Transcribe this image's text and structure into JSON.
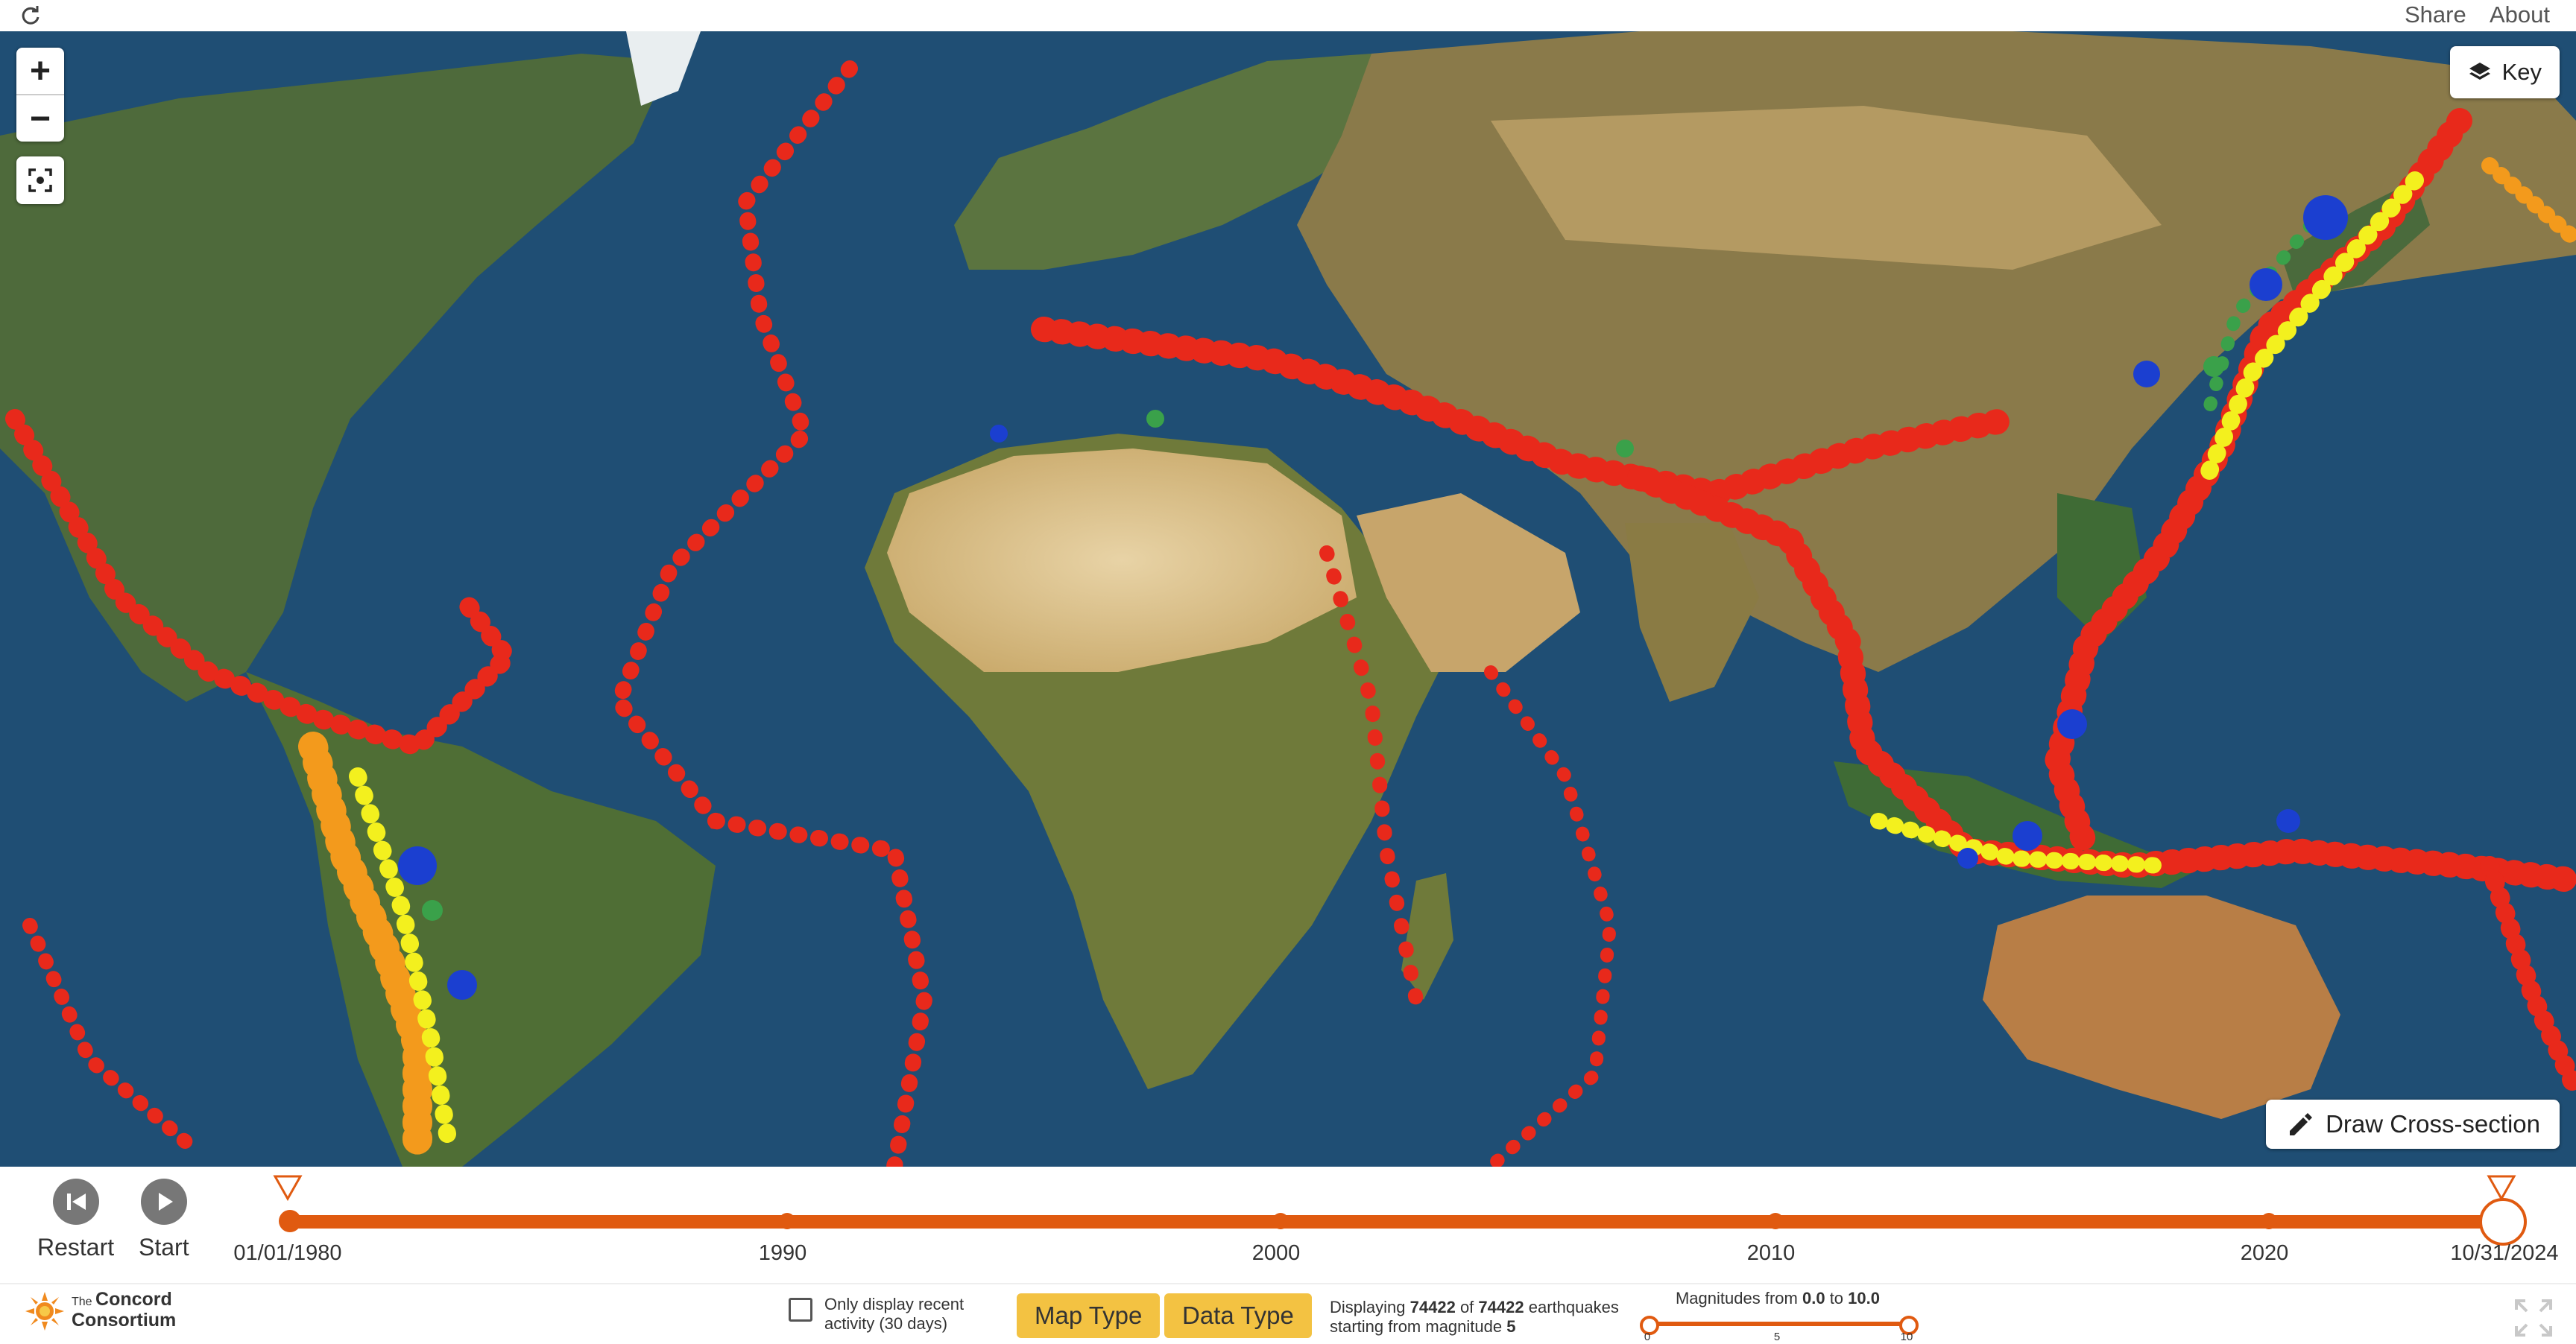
{
  "header": {
    "share_label": "Share",
    "about_label": "About"
  },
  "map": {
    "key_label": "Key",
    "cross_section_label": "Draw Cross-section",
    "zoom_in_label": "+",
    "zoom_out_label": "−"
  },
  "playback": {
    "restart_label": "Restart",
    "start_label": "Start"
  },
  "timeline": {
    "start_date": "01/01/1980",
    "end_date": "10/31/2024",
    "ticks": [
      "1990",
      "2000",
      "2010",
      "2020"
    ]
  },
  "filters": {
    "recent_activity_label": "Only display recent activity (30 days)",
    "map_type_label": "Map Type",
    "data_type_label": "Data Type"
  },
  "status": {
    "displaying_prefix": "Displaying",
    "displayed_count": "74422",
    "of_word": "of",
    "total_count": "74422",
    "earthquakes_word": "earthquakes",
    "starting_text": "starting from magnitude",
    "start_magnitude": "5"
  },
  "magnitude": {
    "prefix": "Magnitudes from",
    "from": "0.0",
    "to_word": "to",
    "to": "10.0",
    "ticks": [
      "0",
      "5",
      "10"
    ]
  },
  "logo": {
    "line1": "The",
    "line2": "Concord",
    "line3": "Consortium"
  },
  "colors": {
    "accent": "#e05a10",
    "button_yellow": "#f3c242",
    "quake_red": "#e8291b",
    "quake_orange": "#f39a1c",
    "quake_yellow": "#f3f01e",
    "quake_green": "#3aa14a",
    "quake_blue": "#1b3fd0"
  },
  "icons": [
    "reload-icon",
    "fit-bounds-icon",
    "layers-icon",
    "pencil-icon",
    "restart-icon",
    "play-icon",
    "fullscreen-icon"
  ]
}
